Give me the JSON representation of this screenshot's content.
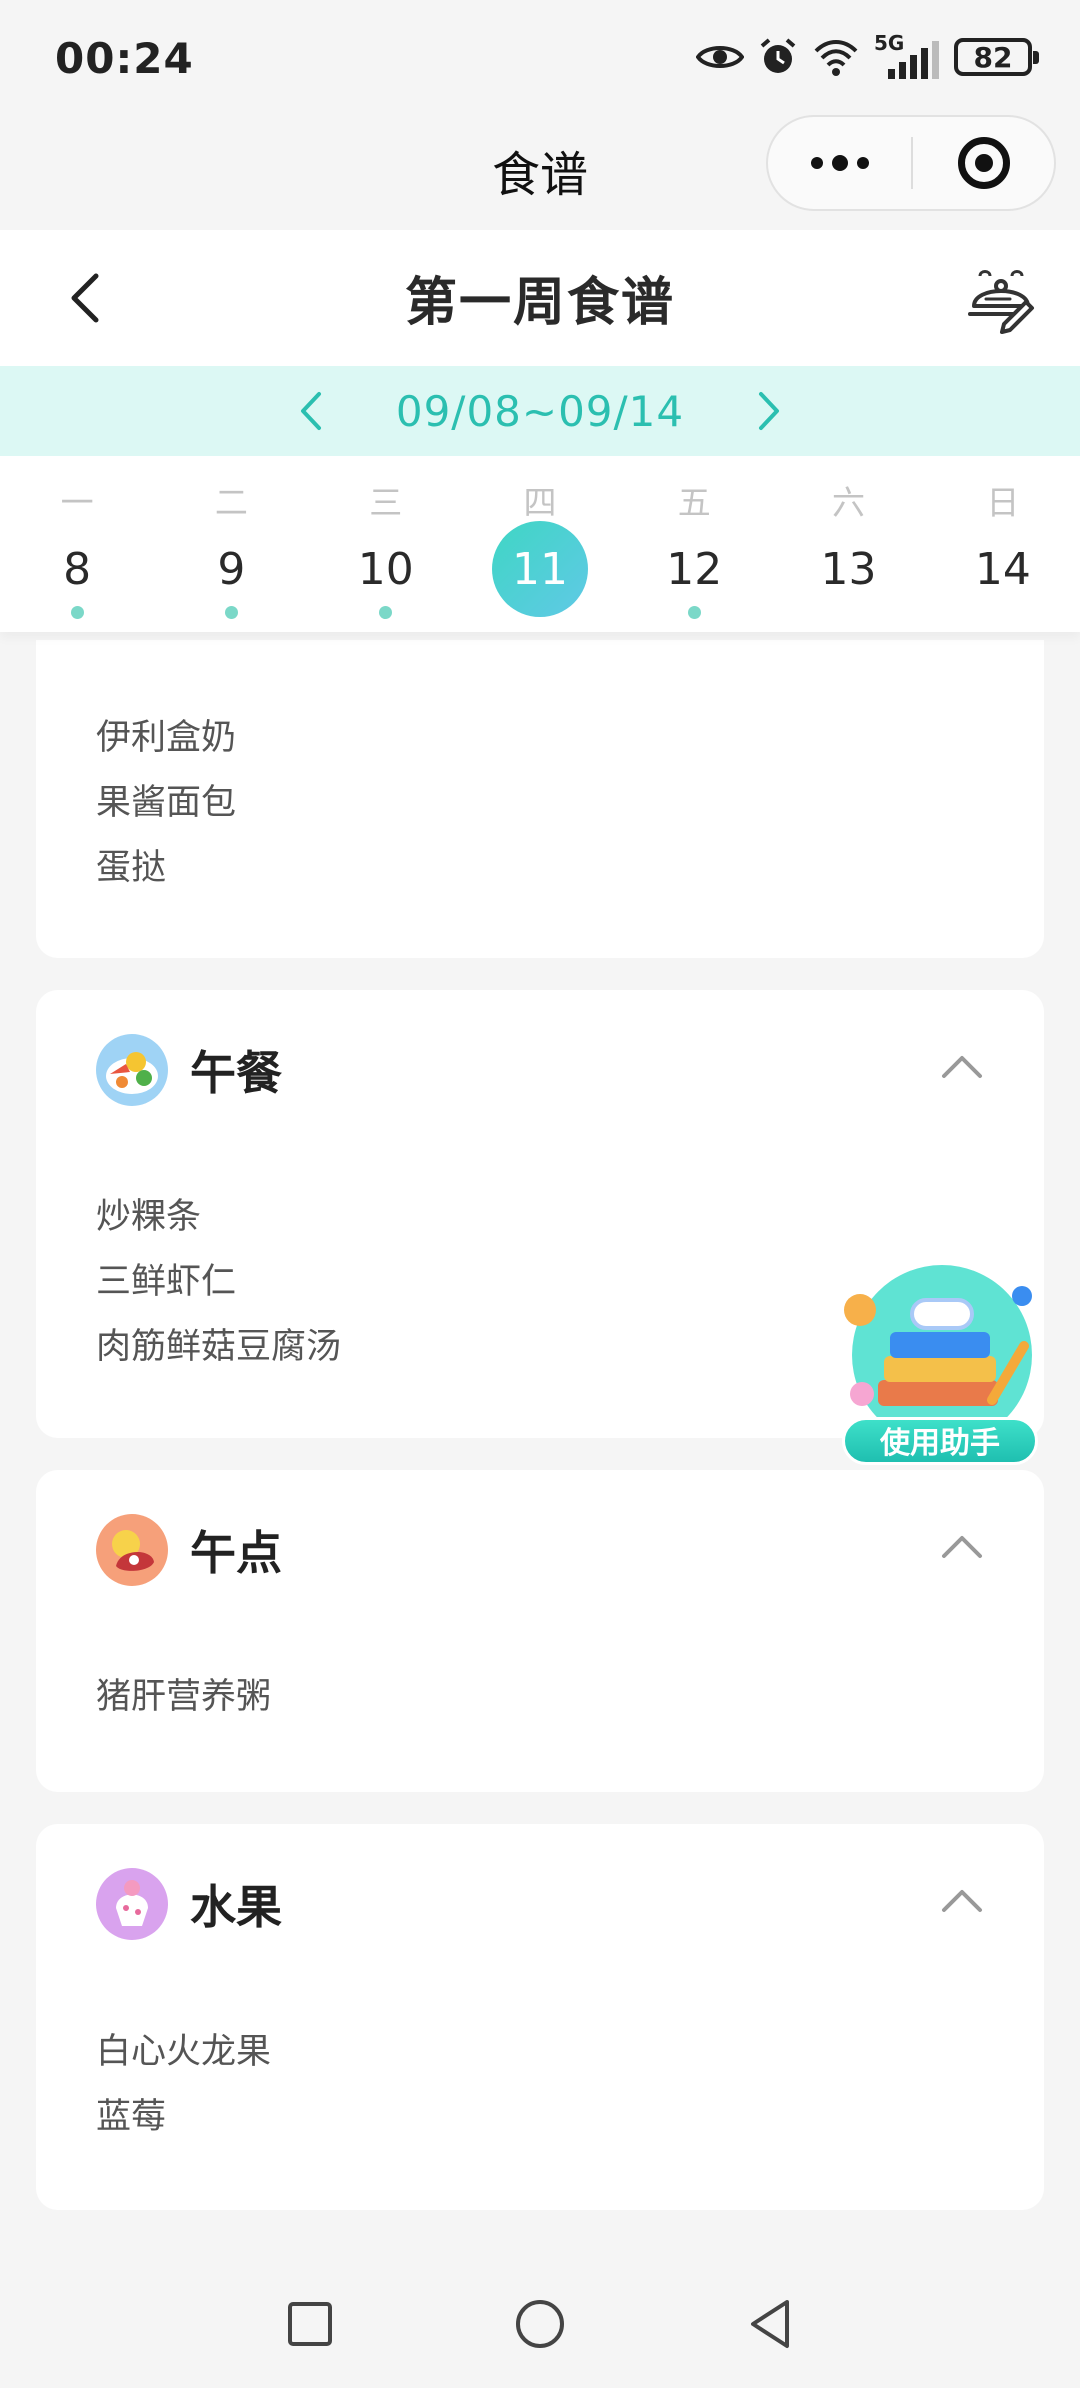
{
  "status_bar": {
    "time": "00:24",
    "network": "5G",
    "battery": "82"
  },
  "mini_program": {
    "title": "食谱"
  },
  "header": {
    "title": "第一周食谱"
  },
  "week": {
    "range": "09/08~09/14"
  },
  "days": [
    {
      "weekday": "一",
      "date": "8",
      "has_dot": true,
      "selected": false
    },
    {
      "weekday": "二",
      "date": "9",
      "has_dot": true,
      "selected": false
    },
    {
      "weekday": "三",
      "date": "10",
      "has_dot": true,
      "selected": false
    },
    {
      "weekday": "四",
      "date": "11",
      "has_dot": false,
      "selected": true
    },
    {
      "weekday": "五",
      "date": "12",
      "has_dot": true,
      "selected": false
    },
    {
      "weekday": "六",
      "date": "13",
      "has_dot": false,
      "selected": false
    },
    {
      "weekday": "日",
      "date": "14",
      "has_dot": false,
      "selected": false
    }
  ],
  "meals": {
    "breakfast": {
      "items": [
        "伊利盒奶",
        "果酱面包",
        "蛋挞"
      ]
    },
    "lunch": {
      "title": "午餐",
      "icon": "lunch-plate-icon",
      "items": [
        "炒粿条",
        "三鲜虾仁",
        "肉筋鲜菇豆腐汤"
      ]
    },
    "snack": {
      "title": "午点",
      "icon": "snack-icon",
      "items": [
        "猪肝营养粥"
      ]
    },
    "fruit": {
      "title": "水果",
      "icon": "fruit-icon",
      "items": [
        "白心火龙果",
        "蓝莓"
      ]
    }
  },
  "helper": {
    "label": "使用助手"
  },
  "colors": {
    "accent": "#2bbfb0",
    "week_bar_bg": "#dcf8f4",
    "dot": "#7bd8c8"
  }
}
